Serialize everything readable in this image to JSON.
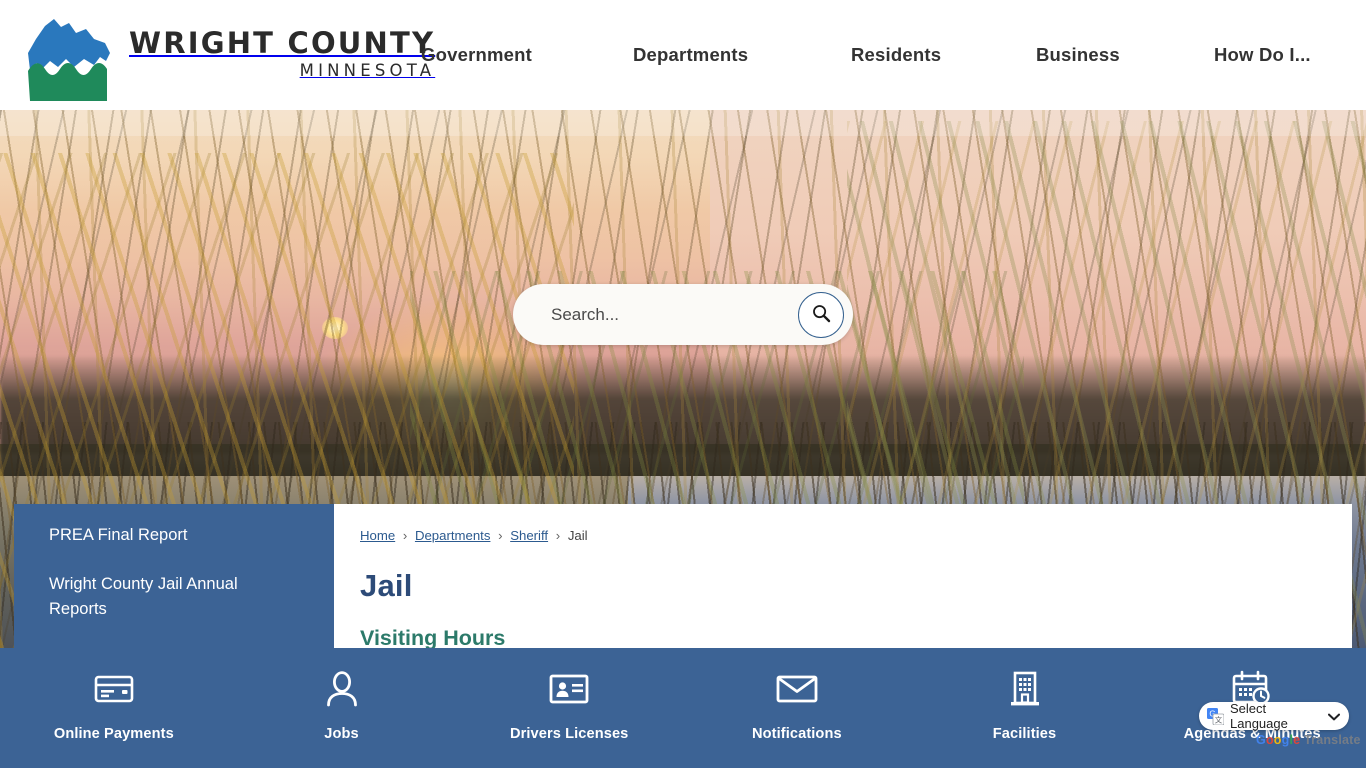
{
  "site": {
    "logo_title": "WRIGHT COUNTY",
    "logo_subtitle": "MINNESOTA",
    "logo_icon": "wright-county-seal-icon",
    "brand_blue": "#3c6395",
    "brand_green": "#1f8a5b",
    "accent_teal": "#2c7a6a",
    "title_navy": "#2d4b78"
  },
  "nav": {
    "items": [
      {
        "label": "Government"
      },
      {
        "label": "Departments"
      },
      {
        "label": "Residents"
      },
      {
        "label": "Business"
      },
      {
        "label": "How Do I..."
      }
    ]
  },
  "hero": {
    "search": {
      "placeholder": "Search...",
      "value": "",
      "button_icon": "search-icon"
    }
  },
  "sidebar": {
    "items": [
      {
        "label": "PREA Final Report"
      },
      {
        "label": "Wright County Jail Annual Reports"
      }
    ]
  },
  "main": {
    "breadcrumb": {
      "links": [
        {
          "label": "Home"
        },
        {
          "label": "Departments"
        },
        {
          "label": "Sheriff"
        }
      ],
      "separator": "›",
      "current": "Jail"
    },
    "page_title": "Jail",
    "section_heading": "Visiting Hours"
  },
  "quicklinks": {
    "items": [
      {
        "label": "Online Payments",
        "icon": "credit-card-icon"
      },
      {
        "label": "Jobs",
        "icon": "person-icon"
      },
      {
        "label": "Drivers Licenses",
        "icon": "id-card-icon"
      },
      {
        "label": "Notifications",
        "icon": "envelope-icon"
      },
      {
        "label": "Facilities",
        "icon": "building-icon"
      },
      {
        "label": "Agendas & Minutes",
        "icon": "calendar-clock-icon"
      }
    ]
  },
  "translate": {
    "label": "Select Language",
    "chevron": "❯",
    "brand": [
      "G",
      "o",
      "o",
      "g",
      "l",
      "e",
      " Translate"
    ]
  }
}
